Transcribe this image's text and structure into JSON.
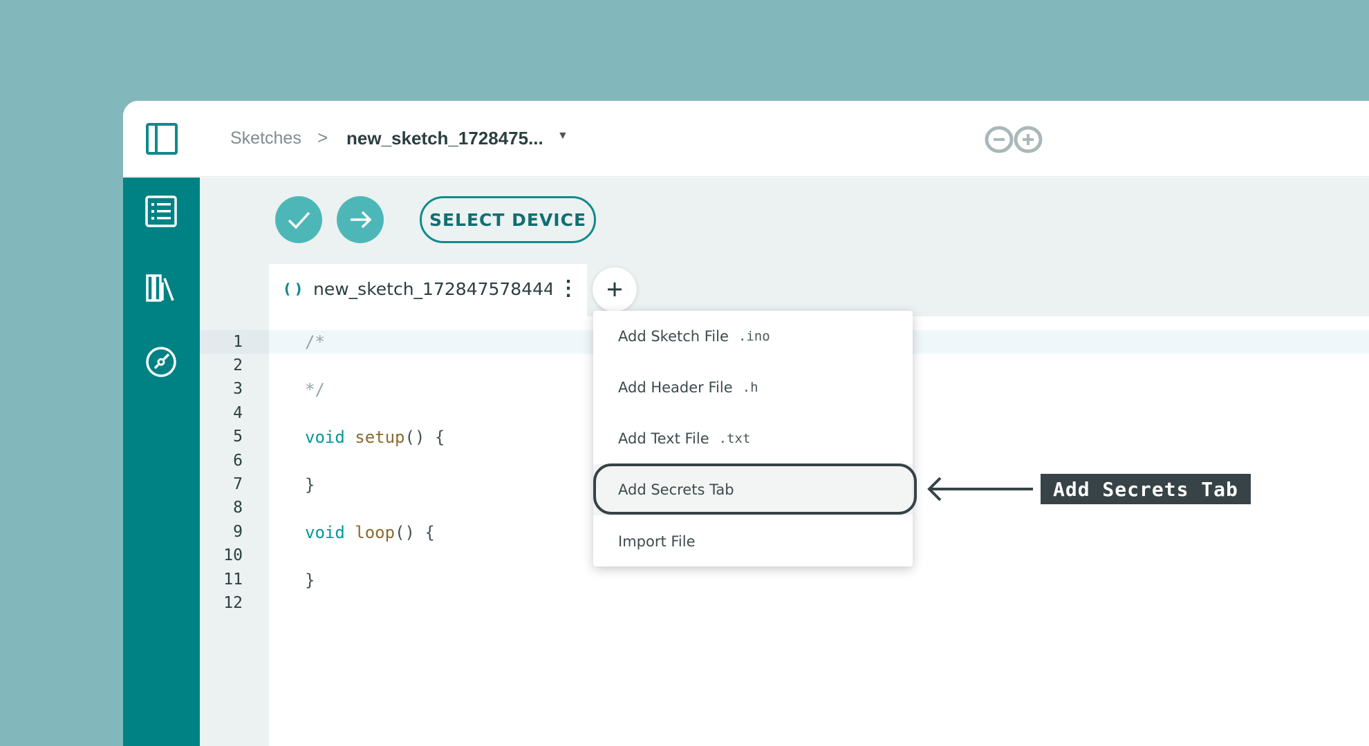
{
  "breadcrumb": {
    "root": "Sketches",
    "separator": ">",
    "current": "new_sketch_1728475..."
  },
  "toolbar": {
    "verify_icon": "checkmark-icon",
    "upload_icon": "arrow-right-icon",
    "select_device_label": "SELECT DEVICE"
  },
  "sidebar": {
    "items": [
      {
        "icon": "sketchbook-icon"
      },
      {
        "icon": "libraries-icon"
      },
      {
        "icon": "reference-compass-icon"
      }
    ]
  },
  "editor": {
    "tab_name": "new_sketch_1728475784440",
    "line_numbers": [
      "1",
      "2",
      "3",
      "4",
      "5",
      "6",
      "7",
      "8",
      "9",
      "10",
      "11",
      "12"
    ],
    "lines": {
      "l1": "/*",
      "l3": "*/",
      "l5_kw": "void",
      "l5_fn": "setup",
      "l5_rest": "() {",
      "l7": "}",
      "l9_kw": "void",
      "l9_fn": "loop",
      "l9_rest": "() {",
      "l11": "}"
    }
  },
  "menu": {
    "items": [
      {
        "label": "Add Sketch File",
        "ext": ".ino"
      },
      {
        "label": "Add Header File",
        "ext": ".h"
      },
      {
        "label": "Add Text File",
        "ext": ".txt"
      },
      {
        "label": "Add Secrets Tab",
        "ext": ""
      },
      {
        "label": "Import File",
        "ext": ""
      }
    ]
  },
  "annotation": {
    "label": "Add Secrets Tab"
  },
  "colors": {
    "background": "#82b8bc",
    "brand_teal": "#008184",
    "button_teal": "#4db7b8",
    "annotation_dark": "#374346"
  }
}
